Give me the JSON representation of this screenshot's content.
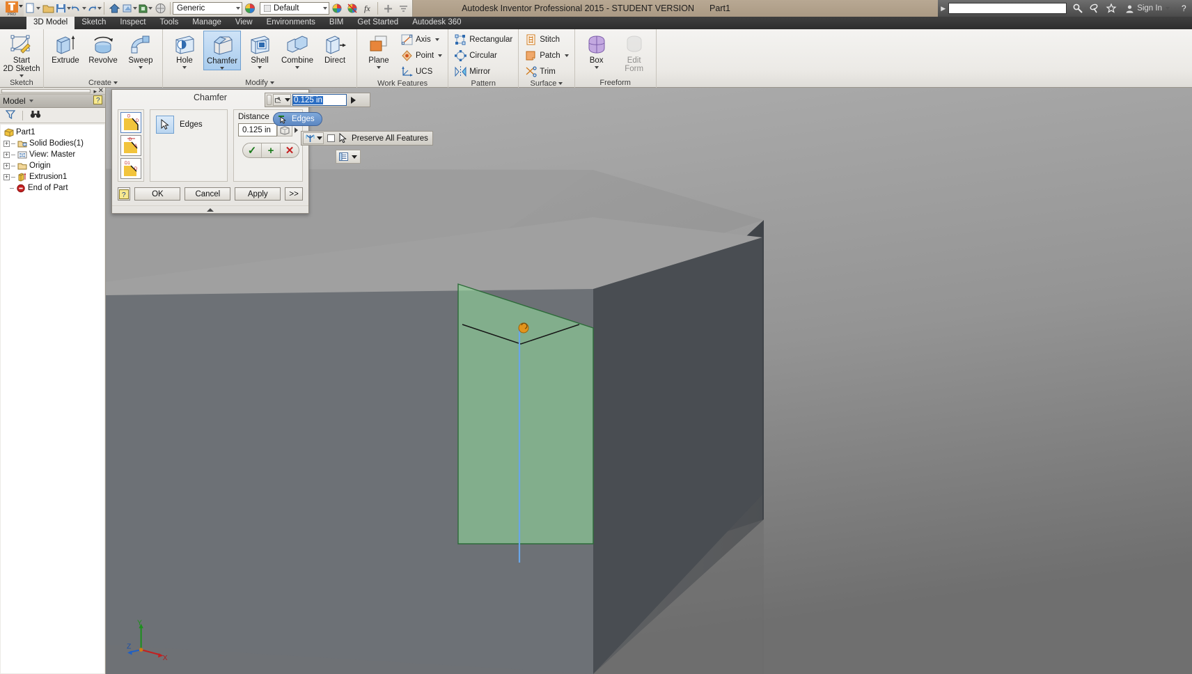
{
  "titlebar": {
    "app_title": "Autodesk Inventor Professional 2015 - STUDENT VERSION",
    "document_name": "Part1",
    "material_combo": "Generic",
    "appearance_combo": "Default",
    "search_placeholder": "",
    "sign_in_label": "Sign In",
    "qat_icons": [
      "new-icon",
      "open-icon",
      "save-icon",
      "undo-icon",
      "redo-icon",
      "home-icon",
      "return-icon",
      "update-icon",
      "appearance-icon"
    ]
  },
  "tabs": [
    {
      "label": "3D Model",
      "active": true
    },
    {
      "label": "Sketch",
      "active": false
    },
    {
      "label": "Inspect",
      "active": false
    },
    {
      "label": "Tools",
      "active": false
    },
    {
      "label": "Manage",
      "active": false
    },
    {
      "label": "View",
      "active": false
    },
    {
      "label": "Environments",
      "active": false
    },
    {
      "label": "BIM",
      "active": false
    },
    {
      "label": "Get Started",
      "active": false
    },
    {
      "label": "Autodesk 360",
      "active": false
    }
  ],
  "ribbon": {
    "panels": [
      {
        "title": "Sketch",
        "big": [
          {
            "label": "Start\n2D Sketch",
            "icon": "start-2d-sketch-icon",
            "has_caret": true,
            "selected": false
          }
        ],
        "small": []
      },
      {
        "title": "Create",
        "title_caret": true,
        "big": [
          {
            "label": "Extrude",
            "icon": "extrude-icon",
            "has_caret": false,
            "selected": false
          },
          {
            "label": "Revolve",
            "icon": "revolve-icon",
            "has_caret": false,
            "selected": false
          },
          {
            "label": "Sweep",
            "icon": "sweep-icon",
            "has_caret": true,
            "selected": false
          }
        ],
        "small": []
      },
      {
        "title": "Modify",
        "title_caret": true,
        "big": [
          {
            "label": "Hole",
            "icon": "hole-icon",
            "has_caret": true,
            "selected": false
          },
          {
            "label": "Chamfer",
            "icon": "chamfer-icon",
            "has_caret": true,
            "selected": true
          },
          {
            "label": "Shell",
            "icon": "shell-icon",
            "has_caret": true,
            "selected": false
          },
          {
            "label": "Combine",
            "icon": "combine-icon",
            "has_caret": true,
            "selected": false
          },
          {
            "label": "Direct",
            "icon": "direct-icon",
            "has_caret": false,
            "selected": false
          }
        ],
        "small": []
      },
      {
        "title": "Work Features",
        "big": [
          {
            "label": "Plane",
            "icon": "plane-icon",
            "has_caret": true,
            "selected": false
          }
        ],
        "small": [
          {
            "label": "Axis",
            "icon": "axis-icon",
            "has_caret": true
          },
          {
            "label": "Point",
            "icon": "point-icon",
            "has_caret": true
          },
          {
            "label": "UCS",
            "icon": "ucs-icon",
            "has_caret": false
          }
        ]
      },
      {
        "title": "Pattern",
        "big": [],
        "small": [
          {
            "label": "Rectangular",
            "icon": "rectangular-pattern-icon",
            "has_caret": false
          },
          {
            "label": "Circular",
            "icon": "circular-pattern-icon",
            "has_caret": false
          },
          {
            "label": "Mirror",
            "icon": "mirror-icon",
            "has_caret": false
          }
        ]
      },
      {
        "title": "Surface",
        "title_caret": true,
        "big": [],
        "small": [
          {
            "label": "Stitch",
            "icon": "stitch-icon",
            "has_caret": false
          },
          {
            "label": "Patch",
            "icon": "patch-icon",
            "has_caret": true
          },
          {
            "label": "Trim",
            "icon": "trim-icon",
            "has_caret": false
          }
        ]
      },
      {
        "title": "Freeform",
        "big": [
          {
            "label": "Box",
            "icon": "freeform-box-icon",
            "has_caret": true,
            "selected": false
          },
          {
            "label": "Edit\nForm",
            "icon": "edit-form-icon",
            "has_caret": false,
            "selected": false,
            "disabled": true
          }
        ],
        "small": []
      }
    ]
  },
  "browser": {
    "panel_title": "Model",
    "help_icon": "help-icon",
    "filter_icon": "filter-icon",
    "find_icon": "binoculars-icon",
    "tree": [
      {
        "label": "Part1",
        "icon": "part-icon",
        "depth": 0,
        "expandable": false
      },
      {
        "label": "Solid Bodies(1)",
        "icon": "solid-bodies-icon",
        "depth": 1,
        "expandable": true
      },
      {
        "label": "View: Master",
        "icon": "view-master-icon",
        "depth": 1,
        "expandable": true
      },
      {
        "label": "Origin",
        "icon": "origin-folder-icon",
        "depth": 1,
        "expandable": true
      },
      {
        "label": "Extrusion1",
        "icon": "extrusion-icon",
        "depth": 1,
        "expandable": true
      },
      {
        "label": "End of Part",
        "icon": "end-of-part-icon",
        "depth": 1,
        "expandable": false
      }
    ]
  },
  "chamfer_dialog": {
    "title": "Chamfer",
    "chamfer_types": [
      {
        "name": "distance-type",
        "selected": true
      },
      {
        "name": "distance-and-angle-type",
        "selected": false
      },
      {
        "name": "two-distances-type",
        "selected": false
      }
    ],
    "edges_label": "Edges",
    "edges_select_icon": "cursor-select-icon",
    "distance_label": "Distance",
    "distance_value": "0.125 in",
    "setback_icon": "edge-chain-icon",
    "ok_pill": {
      "accept": "✓",
      "add": "+",
      "cancel": "✕"
    },
    "buttons": {
      "help": "?",
      "ok": "OK",
      "cancel": "Cancel",
      "apply": "Apply",
      "more": ">>"
    }
  },
  "floating_input": {
    "value": "0.125 in",
    "mode_icon": "chamfer-dim-icon",
    "go_icon": "play-icon"
  },
  "tooltip": {
    "label": "Edges",
    "icon": "edges-pick-icon"
  },
  "preserve": {
    "label": "Preserve All Features",
    "checked": false,
    "chain_icon": "edge-chain-icon",
    "cursor_icon": "arrow-cursor-icon"
  },
  "viewport": {
    "axis_labels": {
      "x": "X",
      "y": "Y",
      "z": "Z"
    },
    "colors": {
      "top_face": "#9e9e9e",
      "left_face": "#6e7277",
      "right_face": "#4b4f54",
      "highlight_face": "#6f8673",
      "highlight_edge": "#2f6b3a",
      "chamfer_preview_edge": "#1a1a1a",
      "axis_line": "#6aa6e8",
      "center_marker": "#e89b1a",
      "background_top": "#a6a6a6",
      "background_bottom": "#787878"
    }
  }
}
